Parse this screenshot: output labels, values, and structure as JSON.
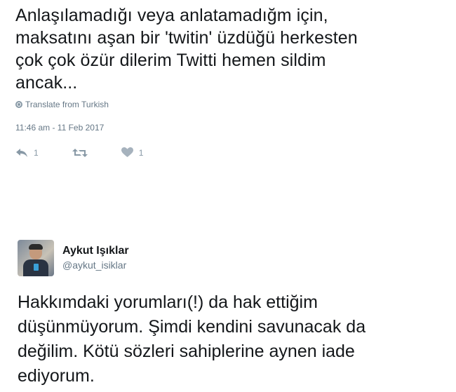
{
  "tweet1": {
    "text": "Anlaşılamadığı veya anlatamadığm için,\nmaksatını aşan bir 'twitin' üzdüğü herkesten\nçok çok özür dilerim  Twitti hemen sildim\nancak...",
    "translate_label": "Translate from Turkish",
    "timestamp": "11:46 am - 11 Feb 2017",
    "actions": {
      "reply_icon": "reply-icon",
      "reply_count": "1",
      "retweet_icon": "retweet-icon",
      "like_icon": "heart-icon",
      "like_count": "1"
    }
  },
  "tweet2": {
    "display_name": "Aykut Işıklar",
    "username": "@aykut_isiklar",
    "text": "Hakkımdaki yorumları(!) da hak ettiğim\ndüşünmüyorum. Şimdi kendini savunacak da\ndeğilim. Kötü sözleri sahiplerine aynen iade\nediyorum."
  },
  "colors": {
    "text": "#14171a",
    "secondary": "#657786",
    "icon": "#8899a6"
  }
}
